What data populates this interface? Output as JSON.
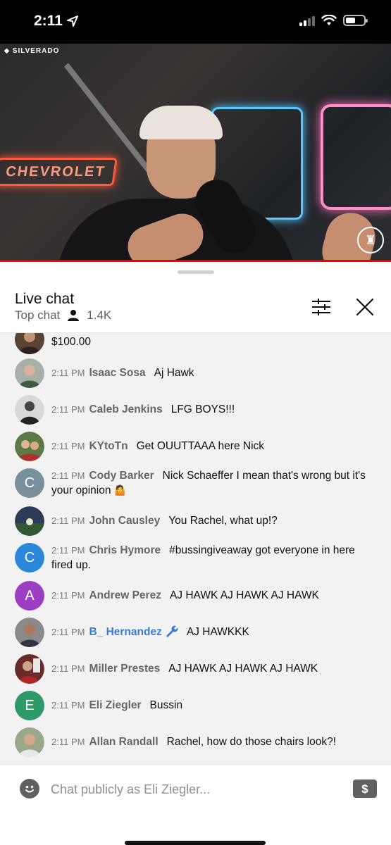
{
  "status_bar": {
    "time": "2:11",
    "icons": [
      "location-arrow-icon",
      "signal-icon",
      "wifi-icon",
      "battery-icon"
    ]
  },
  "video": {
    "brand_text": "SILVERADO",
    "neon_sign_text": "CHEVROLET",
    "progress_percent": 100,
    "progress_color": "#e00000"
  },
  "chat_header": {
    "title": "Live chat",
    "mode": "Top chat",
    "viewer_count": "1.4K"
  },
  "messages": [
    {
      "time": "",
      "author": "",
      "text": "$100.00",
      "avatar_type": "photo",
      "avatar_color": "#4a3a30"
    },
    {
      "time": "2:11 PM",
      "author": "Isaac Sosa",
      "text": "Aj Hawk",
      "avatar_type": "photo",
      "avatar_color": "#7a8a7a"
    },
    {
      "time": "2:11 PM",
      "author": "Caleb Jenkins",
      "text": "LFG BOYS!!!",
      "avatar_type": "photo",
      "avatar_color": "#3a3a3a"
    },
    {
      "time": "2:11 PM",
      "author": "KYtoTn",
      "text": "Get OUUTTAAA here Nick",
      "avatar_type": "photo",
      "avatar_color": "#5a7a4a"
    },
    {
      "time": "2:11 PM",
      "author": "Cody Barker",
      "text": "Nick Schaeffer I mean that's wrong but it's your opinion",
      "emoji": "🤷",
      "avatar_type": "letter",
      "letter": "C",
      "avatar_color": "#78909c"
    },
    {
      "time": "2:11 PM",
      "author": "John Causley",
      "text": "You Rachel, what up!?",
      "avatar_type": "photo",
      "avatar_color": "#2f4a2f"
    },
    {
      "time": "2:11 PM",
      "author": "Chris Hymore",
      "text": "#bussingiveaway got everyone in here fired up.",
      "avatar_type": "letter",
      "letter": "C",
      "avatar_color": "#2b88d8"
    },
    {
      "time": "2:11 PM",
      "author": "Andrew Perez",
      "text": "AJ HAWK AJ HAWK AJ HAWK",
      "avatar_type": "letter",
      "letter": "A",
      "avatar_color": "#9c3ec4"
    },
    {
      "time": "2:11 PM",
      "author": "B_ Hernandez",
      "text": "AJ HAWKKK",
      "avatar_type": "photo",
      "avatar_color": "#6a5040",
      "moderator": true
    },
    {
      "time": "2:11 PM",
      "author": "Miller Prestes",
      "text": "AJ HAWK AJ HAWK AJ HAWK",
      "avatar_type": "photo",
      "avatar_color": "#7a3030"
    },
    {
      "time": "2:11 PM",
      "author": "Eli Ziegler",
      "text": "Bussin",
      "avatar_type": "letter",
      "letter": "E",
      "avatar_color": "#2e9a6a"
    },
    {
      "time": "2:11 PM",
      "author": "Allan Randall",
      "text": "Rachel, how do those chairs look?!",
      "avatar_type": "photo",
      "avatar_color": "#7a8a6a"
    }
  ],
  "composer": {
    "placeholder": "Chat publicly as Eli Ziegler...",
    "value": ""
  },
  "colors": {
    "moderator_name": "#3a7bd5",
    "author_name": "#666666",
    "chat_bg": "#f2f2f2"
  }
}
